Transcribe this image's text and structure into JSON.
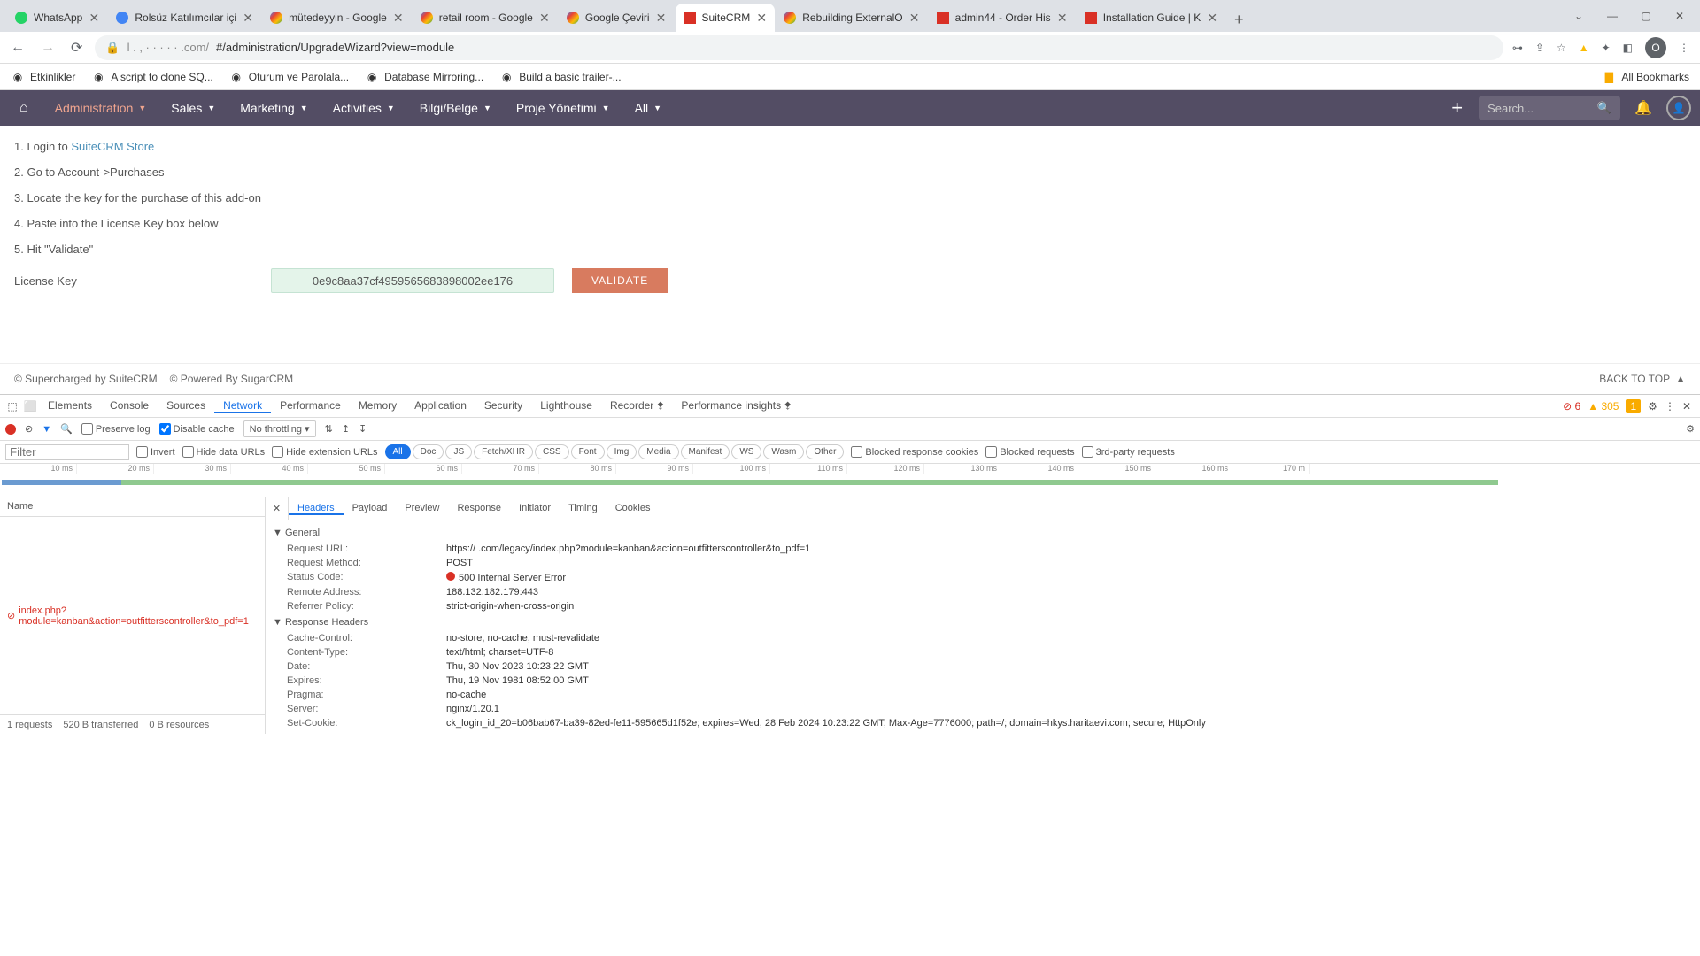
{
  "tabs": [
    {
      "title": "WhatsApp",
      "fav": "green"
    },
    {
      "title": "Rolsüz Katılımcılar içi",
      "fav": "blue"
    },
    {
      "title": "mütedeyyin - Google",
      "fav": "g"
    },
    {
      "title": "retail room - Google",
      "fav": "g"
    },
    {
      "title": "Google Çeviri",
      "fav": "g"
    },
    {
      "title": "SuiteCRM",
      "fav": "red",
      "active": true
    },
    {
      "title": "Rebuilding ExternalO",
      "fav": "g"
    },
    {
      "title": "admin44 - Order His",
      "fav": "red"
    },
    {
      "title": "Installation Guide | K",
      "fav": "red"
    }
  ],
  "url": "#/administration/UpgradeWizard?view=module",
  "url_host": ".com/",
  "bookmarks": [
    {
      "label": "Etkinlikler"
    },
    {
      "label": "A script to clone SQ..."
    },
    {
      "label": "Oturum ve Parolala..."
    },
    {
      "label": "Database Mirroring..."
    },
    {
      "label": "Build a basic trailer-..."
    }
  ],
  "all_bookmarks": "All Bookmarks",
  "nav": {
    "items": [
      "Administration",
      "Sales",
      "Marketing",
      "Activities",
      "Bilgi/Belge",
      "Proje Yönetimi",
      "All"
    ],
    "search_placeholder": "Search..."
  },
  "steps": {
    "s1a": "1. Login to ",
    "s1link": "SuiteCRM Store",
    "s2": "2. Go to Account->Purchases",
    "s3": "3. Locate the key for the purchase of this add-on",
    "s4": "4. Paste into the License Key box below",
    "s5": "5. Hit \"Validate\""
  },
  "license": {
    "label": "License Key",
    "value": "0e9c8aa37cf4959565683898002ee176",
    "btn": "VALIDATE"
  },
  "footer": {
    "left1": "© Supercharged by SuiteCRM",
    "left2": "© Powered By SugarCRM",
    "right": "BACK TO TOP"
  },
  "dt": {
    "tabs": [
      "Elements",
      "Console",
      "Sources",
      "Network",
      "Performance",
      "Memory",
      "Application",
      "Security",
      "Lighthouse",
      "Recorder",
      "Performance insights"
    ],
    "active_tab": "Network",
    "errors": "6",
    "warnings": "305",
    "issues": "1",
    "toolbar": {
      "preserve": "Preserve log",
      "disable": "Disable cache",
      "throttle": "No throttling"
    },
    "filter": {
      "placeholder": "Filter",
      "invert": "Invert",
      "hidedata": "Hide data URLs",
      "hideext": "Hide extension URLs",
      "types": [
        "All",
        "Doc",
        "JS",
        "Fetch/XHR",
        "CSS",
        "Font",
        "Img",
        "Media",
        "Manifest",
        "WS",
        "Wasm",
        "Other"
      ],
      "active_type": "All",
      "blockedcookies": "Blocked response cookies",
      "blockedreq": "Blocked requests",
      "thirdparty": "3rd-party requests"
    },
    "timeline": [
      "10 ms",
      "20 ms",
      "30 ms",
      "40 ms",
      "50 ms",
      "60 ms",
      "70 ms",
      "80 ms",
      "90 ms",
      "100 ms",
      "110 ms",
      "120 ms",
      "130 ms",
      "140 ms",
      "150 ms",
      "160 ms",
      "170 m"
    ],
    "left_hdr": "Name",
    "request": "index.php?module=kanban&action=outfitterscontroller&to_pdf=1",
    "subtabs": [
      "Headers",
      "Payload",
      "Preview",
      "Response",
      "Initiator",
      "Timing",
      "Cookies"
    ],
    "active_subtab": "Headers",
    "general_label": "General",
    "general": [
      {
        "k": "Request URL:",
        "v": "https://              .com/legacy/index.php?module=kanban&action=outfitterscontroller&to_pdf=1"
      },
      {
        "k": "Request Method:",
        "v": "POST"
      },
      {
        "k": "Status Code:",
        "v": "500 Internal Server Error",
        "red": true
      },
      {
        "k": "Remote Address:",
        "v": "188.132.182.179:443"
      },
      {
        "k": "Referrer Policy:",
        "v": "strict-origin-when-cross-origin"
      }
    ],
    "response_label": "Response Headers",
    "response": [
      {
        "k": "Cache-Control:",
        "v": "no-store, no-cache, must-revalidate"
      },
      {
        "k": "Content-Type:",
        "v": "text/html; charset=UTF-8"
      },
      {
        "k": "Date:",
        "v": "Thu, 30 Nov 2023 10:23:22 GMT"
      },
      {
        "k": "Expires:",
        "v": "Thu, 19 Nov 1981 08:52:00 GMT"
      },
      {
        "k": "Pragma:",
        "v": "no-cache"
      },
      {
        "k": "Server:",
        "v": "nginx/1.20.1"
      },
      {
        "k": "Set-Cookie:",
        "v": "ck_login_id_20=b06bab67-ba39-82ed-fe11-595665d1f52e; expires=Wed, 28 Feb 2024 10:23:22 GMT; Max-Age=7776000; path=/; domain=hkys.haritaevi.com; secure; HttpOnly"
      }
    ],
    "bottom": {
      "req": "1 requests",
      "tx": "520 B transferred",
      "res": "0 B resources"
    }
  }
}
